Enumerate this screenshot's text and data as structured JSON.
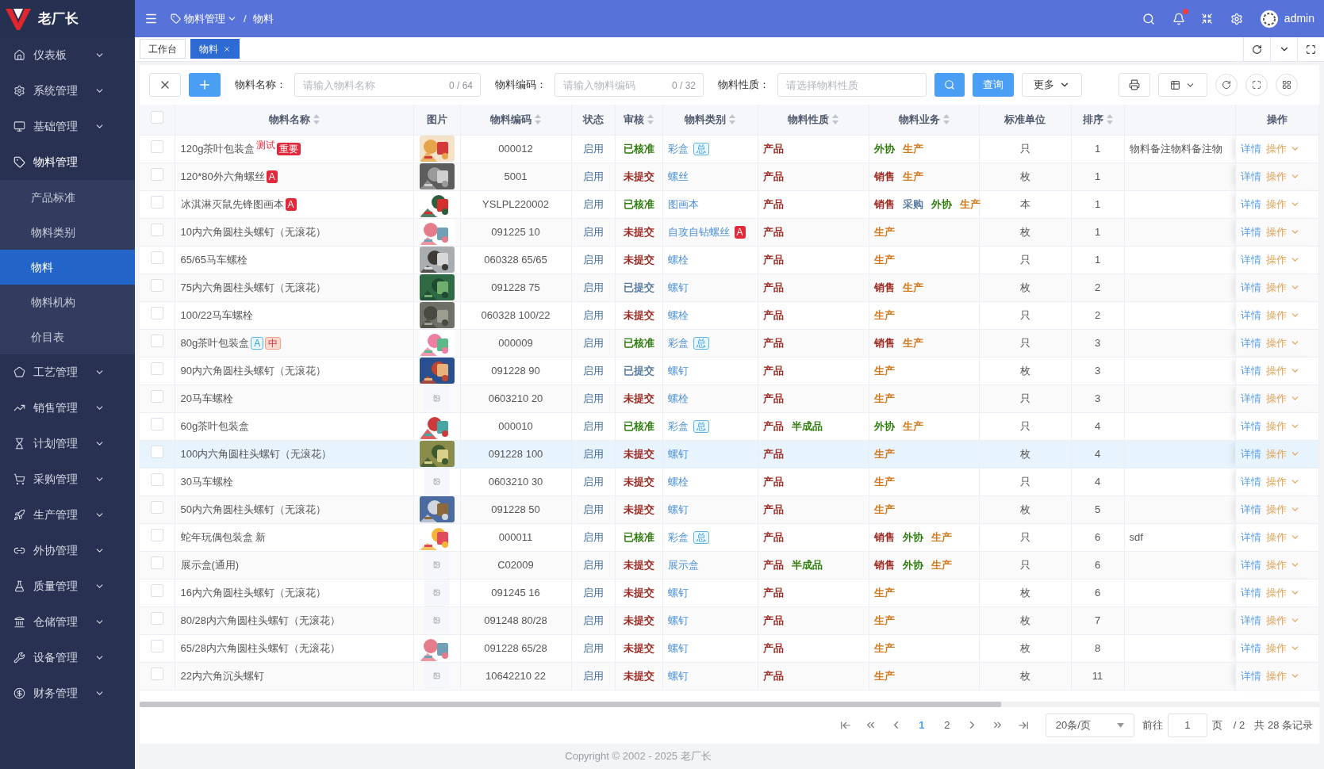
{
  "brand": {
    "name": "老厂长"
  },
  "sidebar": {
    "items": [
      {
        "label": "仪表板",
        "expanded": false
      },
      {
        "label": "系统管理",
        "expanded": false
      },
      {
        "label": "基础管理",
        "expanded": false
      },
      {
        "label": "物料管理",
        "expanded": true,
        "children": [
          {
            "label": "产品标准",
            "selected": false
          },
          {
            "label": "物料类别",
            "selected": false
          },
          {
            "label": "物料",
            "selected": true
          },
          {
            "label": "物料机构",
            "selected": false
          },
          {
            "label": "价目表",
            "selected": false
          }
        ]
      },
      {
        "label": "工艺管理",
        "expanded": false
      },
      {
        "label": "销售管理",
        "expanded": false
      },
      {
        "label": "计划管理",
        "expanded": false
      },
      {
        "label": "采购管理",
        "expanded": false
      },
      {
        "label": "生产管理",
        "expanded": false
      },
      {
        "label": "外协管理",
        "expanded": false
      },
      {
        "label": "质量管理",
        "expanded": false
      },
      {
        "label": "仓储管理",
        "expanded": false
      },
      {
        "label": "设备管理",
        "expanded": false
      },
      {
        "label": "财务管理",
        "expanded": false
      }
    ]
  },
  "header": {
    "breadcrumb": [
      {
        "label": "物料管理",
        "dropdown": true
      },
      {
        "label": "物料",
        "dropdown": false
      }
    ],
    "separator": "/",
    "bell_dot": true,
    "user": "admin"
  },
  "tabs": [
    {
      "label": "工作台",
      "selected": false,
      "closable": false
    },
    {
      "label": "物料",
      "selected": true,
      "closable": true
    }
  ],
  "toolbar": {
    "filters": [
      {
        "label": "物料名称：",
        "placeholder": "请输入物料名称",
        "counter": "0 / 64"
      },
      {
        "label": "物料编码：",
        "placeholder": "请输入物料编码",
        "counter": "0 / 32"
      },
      {
        "label": "物料性质：",
        "placeholder": "请选择物料性质"
      }
    ],
    "query_button": "查询",
    "more_button": "更多"
  },
  "table": {
    "select_all_checked": false,
    "columns": [
      {
        "label": "物料名称",
        "sortable": true
      },
      {
        "label": "图片",
        "sortable": false
      },
      {
        "label": "物料编码",
        "sortable": true
      },
      {
        "label": "状态",
        "sortable": false
      },
      {
        "label": "审核",
        "sortable": true
      },
      {
        "label": "物料类别",
        "sortable": true
      },
      {
        "label": "物料性质",
        "sortable": true
      },
      {
        "label": "物料业务",
        "sortable": true
      },
      {
        "label": "标准单位",
        "sortable": false
      },
      {
        "label": "排序",
        "sortable": true
      },
      {
        "label": "操作",
        "sortable": false
      }
    ],
    "rows": [
      {
        "checked": false,
        "highlighted": false,
        "name": "120g茶叶包装盒",
        "name_tags": [
          {
            "text": "测试",
            "kind": "sup"
          },
          {
            "text": "重要",
            "kind": "red"
          }
        ],
        "image": {
          "kind": "picture"
        },
        "code": "000012",
        "status": "启用",
        "audit": {
          "text": "已核准",
          "color": "#2f7d0f"
        },
        "category": "彩盒",
        "category_tags": [
          {
            "text": "总",
            "kind": "blue"
          }
        ],
        "nature": [
          {
            "text": "产品",
            "color": "#9b2a23"
          }
        ],
        "business": [
          {
            "text": "外协",
            "color": "#2f7d0f"
          },
          {
            "text": "生产",
            "color": "#d07a1f"
          }
        ],
        "unit": "只",
        "sort": "1",
        "remark": "物料备注物料备注物",
        "actions": [
          "详情",
          "操作"
        ]
      },
      {
        "checked": false,
        "highlighted": false,
        "name": "120*80外六角螺丝",
        "name_tags": [
          {
            "text": "A",
            "kind": "red"
          }
        ],
        "image": {
          "kind": "picture"
        },
        "code": "5001",
        "status": "启用",
        "audit": {
          "text": "未提交",
          "color": "#9b2a23"
        },
        "category": "螺丝",
        "nature": [
          {
            "text": "产品",
            "color": "#9b2a23"
          }
        ],
        "business": [
          {
            "text": "销售",
            "color": "#9b2a23"
          },
          {
            "text": "生产",
            "color": "#d07a1f"
          }
        ],
        "unit": "枚",
        "sort": "1",
        "actions": [
          "详情",
          "操作"
        ]
      },
      {
        "checked": false,
        "highlighted": false,
        "name": "冰淇淋灭鼠先锋图画本",
        "name_tags": [
          {
            "text": "A",
            "kind": "red"
          }
        ],
        "image": {
          "kind": "picture"
        },
        "code": "YSLPL220002",
        "status": "启用",
        "audit": {
          "text": "已核准",
          "color": "#2f7d0f"
        },
        "category": "图画本",
        "nature": [
          {
            "text": "产品",
            "color": "#9b2a23"
          }
        ],
        "business": [
          {
            "text": "销售",
            "color": "#9b2a23"
          },
          {
            "text": "采购",
            "color": "#5a7ca0"
          },
          {
            "text": "外协",
            "color": "#2f7d0f"
          },
          {
            "text": "生产",
            "color": "#d07a1f"
          }
        ],
        "unit": "本",
        "sort": "1",
        "actions": [
          "详情",
          "操作"
        ]
      },
      {
        "checked": false,
        "highlighted": false,
        "name": "10内六角圆柱头螺钉（无滚花）",
        "image": {
          "kind": "picture"
        },
        "code": "091225 10",
        "status": "启用",
        "audit": {
          "text": "未提交",
          "color": "#9b2a23"
        },
        "category": "自攻自钻螺丝",
        "category_tags": [
          {
            "text": "A",
            "kind": "red"
          }
        ],
        "nature": [
          {
            "text": "产品",
            "color": "#9b2a23"
          }
        ],
        "business": [
          {
            "text": "生产",
            "color": "#d07a1f"
          }
        ],
        "unit": "枚",
        "sort": "1",
        "actions": [
          "详情",
          "操作"
        ]
      },
      {
        "checked": false,
        "highlighted": false,
        "name": "65/65马车螺栓",
        "image": {
          "kind": "picture"
        },
        "code": "060328 65/65",
        "status": "启用",
        "audit": {
          "text": "未提交",
          "color": "#9b2a23"
        },
        "category": "螺栓",
        "nature": [
          {
            "text": "产品",
            "color": "#9b2a23"
          }
        ],
        "business": [
          {
            "text": "生产",
            "color": "#d07a1f"
          }
        ],
        "unit": "只",
        "sort": "1",
        "actions": [
          "详情",
          "操作"
        ]
      },
      {
        "checked": false,
        "highlighted": false,
        "name": "75内六角圆柱头螺钉（无滚花）",
        "image": {
          "kind": "picture"
        },
        "code": "091228 75",
        "status": "启用",
        "audit": {
          "text": "已提交",
          "color": "#5a7ca0"
        },
        "category": "螺钉",
        "nature": [
          {
            "text": "产品",
            "color": "#9b2a23"
          }
        ],
        "business": [
          {
            "text": "销售",
            "color": "#9b2a23"
          },
          {
            "text": "生产",
            "color": "#d07a1f"
          }
        ],
        "unit": "枚",
        "sort": "2",
        "actions": [
          "详情",
          "操作"
        ]
      },
      {
        "checked": false,
        "highlighted": false,
        "name": "100/22马车螺栓",
        "image": {
          "kind": "picture"
        },
        "code": "060328 100/22",
        "status": "启用",
        "audit": {
          "text": "未提交",
          "color": "#9b2a23"
        },
        "category": "螺栓",
        "nature": [
          {
            "text": "产品",
            "color": "#9b2a23"
          }
        ],
        "business": [
          {
            "text": "生产",
            "color": "#d07a1f"
          }
        ],
        "unit": "只",
        "sort": "2",
        "actions": [
          "详情",
          "操作"
        ]
      },
      {
        "checked": false,
        "highlighted": false,
        "name": "80g茶叶包装盒",
        "name_tags": [
          {
            "text": "A",
            "kind": "blue"
          },
          {
            "text": "中",
            "kind": "orange"
          }
        ],
        "image": {
          "kind": "picture"
        },
        "code": "000009",
        "status": "启用",
        "audit": {
          "text": "已核准",
          "color": "#2f7d0f"
        },
        "category": "彩盒",
        "category_tags": [
          {
            "text": "总",
            "kind": "blue"
          }
        ],
        "nature": [
          {
            "text": "产品",
            "color": "#9b2a23"
          }
        ],
        "business": [
          {
            "text": "销售",
            "color": "#9b2a23"
          },
          {
            "text": "生产",
            "color": "#d07a1f"
          }
        ],
        "unit": "只",
        "sort": "3",
        "actions": [
          "详情",
          "操作"
        ]
      },
      {
        "checked": false,
        "highlighted": false,
        "name": "90内六角圆柱头螺钉（无滚花）",
        "image": {
          "kind": "picture"
        },
        "code": "091228 90",
        "status": "启用",
        "audit": {
          "text": "已提交",
          "color": "#5a7ca0"
        },
        "category": "螺钉",
        "nature": [
          {
            "text": "产品",
            "color": "#9b2a23"
          }
        ],
        "business": [
          {
            "text": "生产",
            "color": "#d07a1f"
          }
        ],
        "unit": "枚",
        "sort": "3",
        "actions": [
          "详情",
          "操作"
        ]
      },
      {
        "checked": false,
        "highlighted": false,
        "name": "20马车螺栓",
        "image": {
          "kind": "placeholder"
        },
        "code": "0603210 20",
        "status": "启用",
        "audit": {
          "text": "未提交",
          "color": "#9b2a23"
        },
        "category": "螺栓",
        "nature": [
          {
            "text": "产品",
            "color": "#9b2a23"
          }
        ],
        "business": [
          {
            "text": "生产",
            "color": "#d07a1f"
          }
        ],
        "unit": "只",
        "sort": "3",
        "actions": [
          "详情",
          "操作"
        ]
      },
      {
        "checked": false,
        "highlighted": false,
        "name": "60g茶叶包装盒",
        "image": {
          "kind": "picture"
        },
        "code": "000010",
        "status": "启用",
        "audit": {
          "text": "已核准",
          "color": "#2f7d0f"
        },
        "category": "彩盒",
        "category_tags": [
          {
            "text": "总",
            "kind": "blue"
          }
        ],
        "nature": [
          {
            "text": "产品",
            "color": "#9b2a23"
          },
          {
            "text": "半成品",
            "color": "#2f7d0f"
          }
        ],
        "business": [
          {
            "text": "外协",
            "color": "#2f7d0f"
          },
          {
            "text": "生产",
            "color": "#d07a1f"
          }
        ],
        "unit": "只",
        "sort": "4",
        "actions": [
          "详情",
          "操作"
        ]
      },
      {
        "checked": false,
        "highlighted": true,
        "name": "100内六角圆柱头螺钉（无滚花）",
        "image": {
          "kind": "picture"
        },
        "code": "091228 100",
        "status": "启用",
        "audit": {
          "text": "未提交",
          "color": "#9b2a23"
        },
        "category": "螺钉",
        "nature": [
          {
            "text": "产品",
            "color": "#9b2a23"
          }
        ],
        "business": [
          {
            "text": "生产",
            "color": "#d07a1f"
          }
        ],
        "unit": "枚",
        "sort": "4",
        "actions": [
          "详情",
          "操作"
        ]
      },
      {
        "checked": false,
        "highlighted": false,
        "name": "30马车螺栓",
        "image": {
          "kind": "placeholder"
        },
        "code": "0603210 30",
        "status": "启用",
        "audit": {
          "text": "未提交",
          "color": "#9b2a23"
        },
        "category": "螺栓",
        "nature": [
          {
            "text": "产品",
            "color": "#9b2a23"
          }
        ],
        "business": [
          {
            "text": "生产",
            "color": "#d07a1f"
          }
        ],
        "unit": "只",
        "sort": "4",
        "actions": [
          "详情",
          "操作"
        ]
      },
      {
        "checked": false,
        "highlighted": false,
        "name": "50内六角圆柱头螺钉（无滚花）",
        "image": {
          "kind": "picture"
        },
        "code": "091228 50",
        "status": "启用",
        "audit": {
          "text": "未提交",
          "color": "#9b2a23"
        },
        "category": "螺钉",
        "nature": [
          {
            "text": "产品",
            "color": "#9b2a23"
          }
        ],
        "business": [
          {
            "text": "生产",
            "color": "#d07a1f"
          }
        ],
        "unit": "枚",
        "sort": "5",
        "actions": [
          "详情",
          "操作"
        ]
      },
      {
        "checked": false,
        "highlighted": false,
        "name": "蛇年玩偶包装盒 新",
        "image": {
          "kind": "picture"
        },
        "code": "000011",
        "status": "启用",
        "audit": {
          "text": "已核准",
          "color": "#2f7d0f"
        },
        "category": "彩盒",
        "category_tags": [
          {
            "text": "总",
            "kind": "blue"
          }
        ],
        "nature": [
          {
            "text": "产品",
            "color": "#9b2a23"
          }
        ],
        "business": [
          {
            "text": "销售",
            "color": "#9b2a23"
          },
          {
            "text": "外协",
            "color": "#2f7d0f"
          },
          {
            "text": "生产",
            "color": "#d07a1f"
          }
        ],
        "unit": "只",
        "sort": "6",
        "remark": "sdf",
        "actions": [
          "详情",
          "操作"
        ]
      },
      {
        "checked": false,
        "highlighted": false,
        "name": "展示盒(通用)",
        "image": {
          "kind": "placeholder"
        },
        "code": "C02009",
        "status": "启用",
        "audit": {
          "text": "未提交",
          "color": "#9b2a23"
        },
        "category": "展示盒",
        "nature": [
          {
            "text": "产品",
            "color": "#9b2a23"
          },
          {
            "text": "半成品",
            "color": "#2f7d0f"
          }
        ],
        "business": [
          {
            "text": "销售",
            "color": "#9b2a23"
          },
          {
            "text": "外协",
            "color": "#2f7d0f"
          },
          {
            "text": "生产",
            "color": "#d07a1f"
          }
        ],
        "unit": "只",
        "sort": "6",
        "actions": [
          "详情",
          "操作"
        ]
      },
      {
        "checked": false,
        "highlighted": false,
        "name": "16内六角圆柱头螺钉（无滚花）",
        "image": {
          "kind": "placeholder"
        },
        "code": "091245 16",
        "status": "启用",
        "audit": {
          "text": "未提交",
          "color": "#9b2a23"
        },
        "category": "螺钉",
        "nature": [
          {
            "text": "产品",
            "color": "#9b2a23"
          }
        ],
        "business": [
          {
            "text": "生产",
            "color": "#d07a1f"
          }
        ],
        "unit": "枚",
        "sort": "6",
        "actions": [
          "详情",
          "操作"
        ]
      },
      {
        "checked": false,
        "highlighted": false,
        "name": "80/28内六角圆柱头螺钉（无滚花）",
        "image": {
          "kind": "placeholder"
        },
        "code": "091248 80/28",
        "status": "启用",
        "audit": {
          "text": "未提交",
          "color": "#9b2a23"
        },
        "category": "螺钉",
        "nature": [
          {
            "text": "产品",
            "color": "#9b2a23"
          }
        ],
        "business": [
          {
            "text": "生产",
            "color": "#d07a1f"
          }
        ],
        "unit": "枚",
        "sort": "7",
        "actions": [
          "详情",
          "操作"
        ]
      },
      {
        "checked": false,
        "highlighted": false,
        "name": "65/28内六角圆柱头螺钉（无滚花）",
        "image": {
          "kind": "picture"
        },
        "code": "091228 65/28",
        "status": "启用",
        "audit": {
          "text": "未提交",
          "color": "#9b2a23"
        },
        "category": "螺钉",
        "nature": [
          {
            "text": "产品",
            "color": "#9b2a23"
          }
        ],
        "business": [
          {
            "text": "生产",
            "color": "#d07a1f"
          }
        ],
        "unit": "枚",
        "sort": "8",
        "actions": [
          "详情",
          "操作"
        ]
      },
      {
        "checked": false,
        "highlighted": false,
        "name": "22内六角沉头螺钉",
        "image": {
          "kind": "placeholder"
        },
        "code": "10642210 22",
        "status": "启用",
        "audit": {
          "text": "未提交",
          "color": "#9b2a23"
        },
        "category": "螺钉",
        "nature": [
          {
            "text": "产品",
            "color": "#9b2a23"
          }
        ],
        "business": [
          {
            "text": "生产",
            "color": "#d07a1f"
          }
        ],
        "unit": "枚",
        "sort": "11",
        "actions": [
          "详情",
          "操作"
        ]
      }
    ]
  },
  "pagination": {
    "pages": [
      {
        "label": "1",
        "selected": true
      },
      {
        "label": "2",
        "selected": false
      }
    ],
    "page_size": "20条/页",
    "goto_label": "前往",
    "goto_value": "1",
    "page_suffix": "页",
    "total_pages": "/ 2",
    "total": "共 28 条记录"
  },
  "footer": {
    "copyright": "Copyright © 2002 - 2025 老厂长"
  }
}
